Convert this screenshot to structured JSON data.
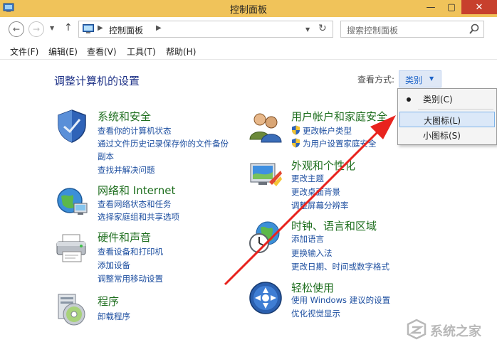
{
  "window": {
    "title": "控制面板"
  },
  "nav": {
    "breadcrumb": "控制面板",
    "search_placeholder": "搜索控制面板"
  },
  "menu": [
    {
      "label": "文件(F)"
    },
    {
      "label": "编辑(E)"
    },
    {
      "label": "查看(V)"
    },
    {
      "label": "工具(T)"
    },
    {
      "label": "帮助(H)"
    }
  ],
  "page": {
    "title": "调整计算机的设置",
    "view_by_label": "查看方式:",
    "view_by_value": "类别"
  },
  "categories": {
    "system": {
      "title": "系统和安全",
      "icon": "shield-icon",
      "links": [
        "查看你的计算机状态",
        "通过文件历史记录保存你的文件备份",
        "副本",
        "查找并解决问题"
      ]
    },
    "network": {
      "title": "网络和 Internet",
      "icon": "network-globe-icon",
      "links": [
        "查看网络状态和任务",
        "选择家庭组和共享选项"
      ]
    },
    "hardware": {
      "title": "硬件和声音",
      "icon": "printer-icon",
      "links": [
        "查看设备和打印机",
        "添加设备",
        "调整常用移动设置"
      ]
    },
    "programs": {
      "title": "程序",
      "icon": "programs-disc-icon",
      "links": [
        "卸载程序"
      ]
    },
    "users": {
      "title": "用户帐户和家庭安全",
      "icon": "users-icon",
      "links": [
        "更改帐户类型",
        "为用户设置家庭安全"
      ]
    },
    "appearance": {
      "title": "外观和个性化",
      "icon": "appearance-icon",
      "links": [
        "更改主题",
        "更改桌面背景",
        "调整屏幕分辨率"
      ]
    },
    "clock": {
      "title": "时钟、语言和区域",
      "icon": "clock-globe-icon",
      "links": [
        "添加语言",
        "更换输入法",
        "更改日期、时间或数字格式"
      ]
    },
    "ease": {
      "title": "轻松使用",
      "icon": "ease-of-access-icon",
      "links": [
        "使用 Windows 建议的设置",
        "优化视觉显示"
      ]
    }
  },
  "view_menu": {
    "items": [
      {
        "label": "类别(C)",
        "selected": true
      },
      {
        "label": "大图标(L)",
        "highlighted": true
      },
      {
        "label": "小图标(S)"
      }
    ]
  },
  "watermark": {
    "text": "系统之家"
  },
  "colors": {
    "titlebar": "#f0c35a",
    "close_button": "#c7402d",
    "heading": "#1e3287",
    "category_title": "#1e6e1e",
    "link": "#1e4fa0",
    "arrow": "#e8231e"
  }
}
